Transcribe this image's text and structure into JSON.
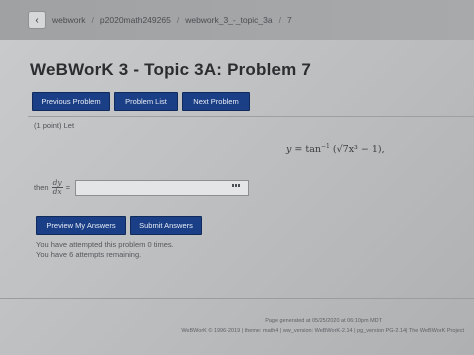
{
  "breadcrumb": {
    "items": [
      "webwork",
      "p2020math249265",
      "webwork_3_-_topic_3a",
      "7"
    ],
    "separator": "/"
  },
  "page_title": "WeBWorK 3 - Topic 3A: Problem 7",
  "nav": {
    "previous": "Previous Problem",
    "list": "Problem List",
    "next": "Next Problem"
  },
  "problem": {
    "points": "(1 point) Let",
    "equation_lhs": "y =",
    "equation_func": "tan",
    "equation_exp": "−1",
    "equation_arg": "(√7x³ − 1),",
    "then_label": "then",
    "frac_num": "dy",
    "frac_den": "dx",
    "equals": "=",
    "answer_value": ""
  },
  "actions": {
    "preview": "Preview My Answers",
    "submit": "Submit Answers"
  },
  "attempts": {
    "line1": "You have attempted this problem 0 times.",
    "line2": "You have 6 attempts remaining."
  },
  "footer": {
    "generated": "Page generated at 05/25/2020 at 06:10pm MDT",
    "copyright": "WeBWorK © 1996-2019 | theme: math4 | ww_version: WeBWorK-2.14 | pg_version PG-2.14| The WeBWorK Project"
  },
  "icons": {
    "back": "chevron-left-icon",
    "answer_helper": "grid-icon"
  },
  "colors": {
    "button_bg": "#1a3f86",
    "button_text": "#e8ecf5"
  }
}
